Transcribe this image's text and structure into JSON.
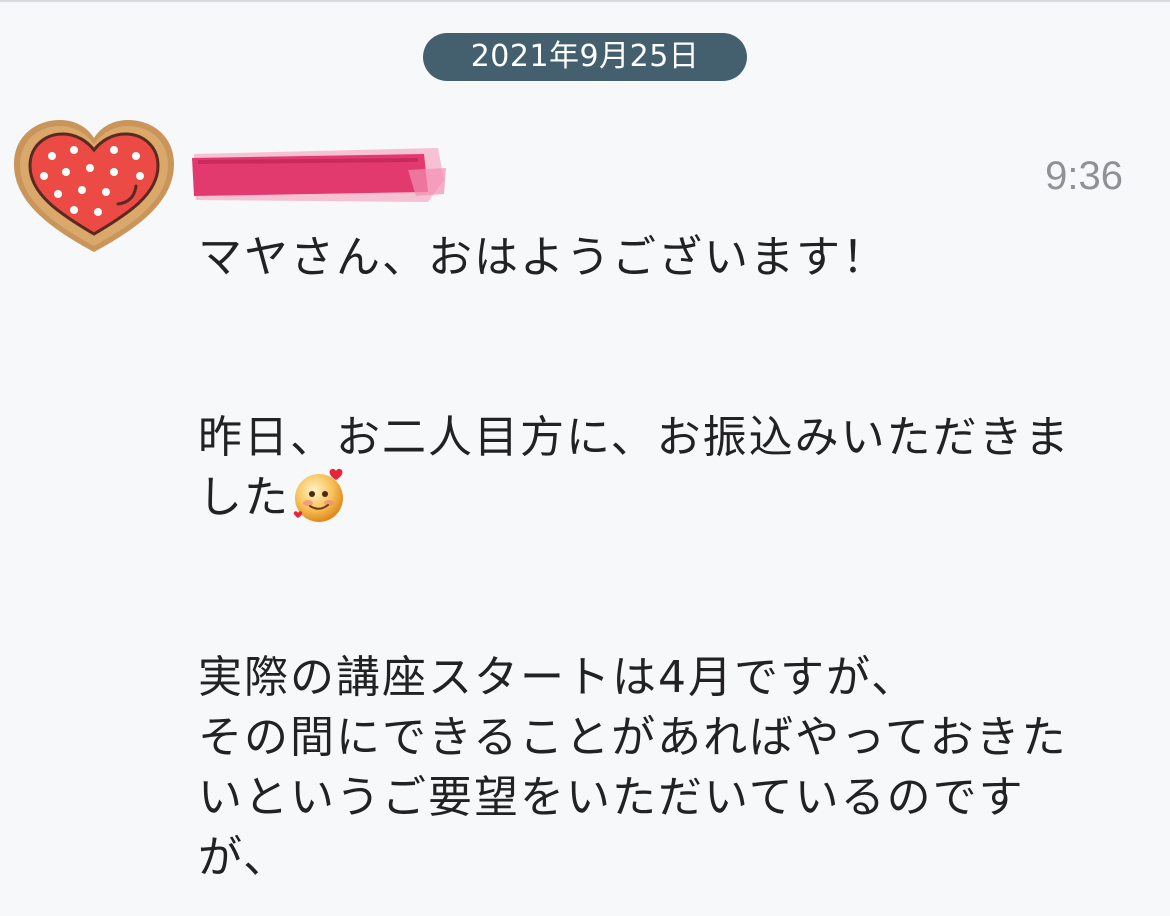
{
  "header": {
    "date_label": "2021年9月25日"
  },
  "message": {
    "time": "9:36",
    "avatar_icon": "heart-cookie-avatar",
    "sender_name_redacted": true,
    "emoji_icon": "smiling-face-with-hearts-icon",
    "lines": {
      "l1": "マヤさん、おはようございます！",
      "l2": "昨日、お二人目方に、お振込みいただきま",
      "l3": "した",
      "l4": "実際の講座スタートは4月ですが、",
      "l5": "その間にできることがあればやっておきた",
      "l6": "いというご要望をいただいているのです",
      "l7": "が、"
    }
  },
  "colors": {
    "background": "#f7f8fa",
    "date_pill": "#44606f",
    "timestamp": "#8e9296",
    "redaction": "#e23a6e"
  }
}
